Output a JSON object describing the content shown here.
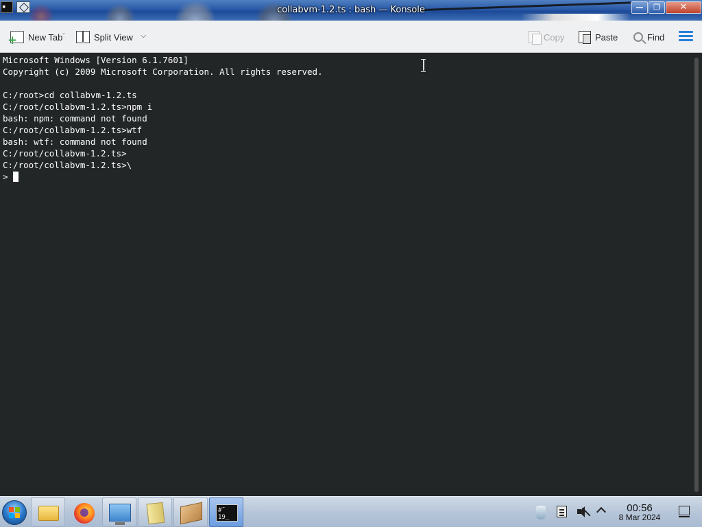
{
  "window": {
    "title": "collabvm-1.2.ts : bash — Konsole",
    "app_icon_text": "▪"
  },
  "toolbar": {
    "new_tab": "New Tab",
    "split_view": "Split View",
    "copy": "Copy",
    "paste": "Paste",
    "find": "Find"
  },
  "terminal": {
    "lines": [
      "Microsoft Windows [Version 6.1.7601]",
      "Copyright (c) 2009 Microsoft Corporation. All rights reserved.",
      "",
      "C:/root>cd collabvm-1.2.ts",
      "C:/root/collabvm-1.2.ts>npm i",
      "bash: npm: command not found",
      "C:/root/collabvm-1.2.ts>wtf",
      "bash: wtf: command not found",
      "C:/root/collabvm-1.2.ts>",
      "C:/root/collabvm-1.2.ts>\\"
    ],
    "prompt": "> "
  },
  "taskbar": {
    "konsole_icon_text": "#˜ 19_",
    "clock_time": "00:56",
    "clock_date": "8 Mar 2024"
  },
  "icons": {
    "title_app": "konsole-icon",
    "title_menu": "window-menu-icon",
    "new_tab": "new-tab-icon",
    "split_view": "split-view-icon",
    "copy": "copy-icon",
    "paste": "paste-icon",
    "find": "find-icon",
    "menu": "hamburger-icon",
    "start": "windows-start-icon",
    "explorer": "folder-icon",
    "firefox": "firefox-icon",
    "rdp": "remote-desktop-icon",
    "notes": "paper-icon",
    "package": "package-icon",
    "konsole": "konsole-icon"
  },
  "colors": {
    "terminal_bg": "#232627",
    "terminal_fg": "#fcfcfc",
    "toolbar_bg": "#eff0f1",
    "accent": "#2980d9"
  }
}
